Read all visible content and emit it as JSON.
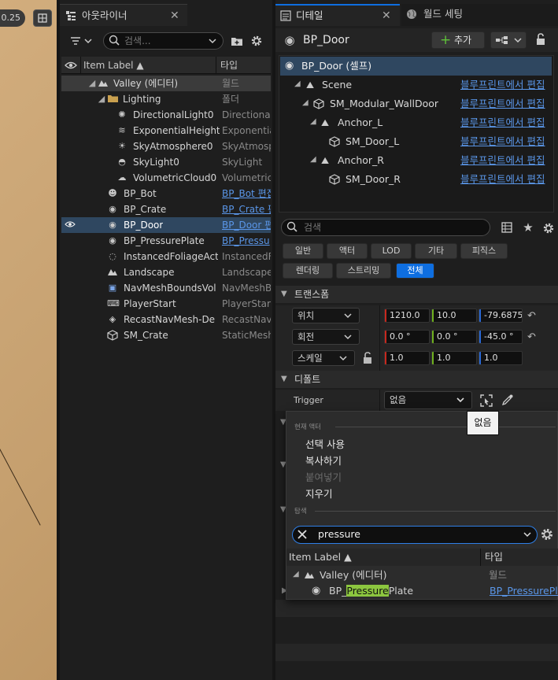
{
  "viewport": {
    "zoom": "0.25"
  },
  "outliner": {
    "tab": "아웃라이너",
    "search_placeholder": "검색...",
    "columns": {
      "label": "Item Label ▲",
      "type": "타입"
    },
    "rows": [
      {
        "label": "Valley (에디터)",
        "type": "월드"
      },
      {
        "label": "Lighting",
        "type": "폴더"
      },
      {
        "label": "DirectionalLight0",
        "type": "Directional"
      },
      {
        "label": "ExponentialHeightF",
        "type": "Exponentia"
      },
      {
        "label": "SkyAtmosphere0",
        "type": "SkyAtmosp"
      },
      {
        "label": "SkyLight0",
        "type": "SkyLight"
      },
      {
        "label": "VolumetricCloud0",
        "type": "Volumetric"
      },
      {
        "label": "BP_Bot",
        "type": "BP_Bot 편집"
      },
      {
        "label": "BP_Crate",
        "type": "BP_Crate 편"
      },
      {
        "label": "BP_Door",
        "type": "BP_Door 편"
      },
      {
        "label": "BP_PressurePlate",
        "type": "BP_Pressu"
      },
      {
        "label": "InstancedFoliageAct",
        "type": "InstancedF"
      },
      {
        "label": "Landscape",
        "type": "Landscape"
      },
      {
        "label": "NavMeshBoundsVol",
        "type": "NavMeshB"
      },
      {
        "label": "PlayerStart",
        "type": "PlayerStart"
      },
      {
        "label": "RecastNavMesh-De",
        "type": "RecastNav"
      },
      {
        "label": "SM_Crate",
        "type": "StaticMesh"
      }
    ]
  },
  "details": {
    "tab": "디테일",
    "world_tab": "월드 세팅",
    "actor_name": "BP_Door",
    "add_label": "추가",
    "components": [
      {
        "name": "BP_Door (셀프)",
        "link": ""
      },
      {
        "name": "Scene",
        "link": "블루프린트에서 편집"
      },
      {
        "name": "SM_Modular_WallDoor",
        "link": "블루프린트에서 편집"
      },
      {
        "name": "Anchor_L",
        "link": "블루프린트에서 편집"
      },
      {
        "name": "SM_Door_L",
        "link": "블루프린트에서 편집"
      },
      {
        "name": "Anchor_R",
        "link": "블루프린트에서 편집"
      },
      {
        "name": "SM_Door_R",
        "link": "블루프린트에서 편집"
      }
    ],
    "search_placeholder": "검색",
    "categories": [
      "일반",
      "액터",
      "LOD",
      "기타",
      "피직스",
      "렌더링",
      "스트리밍",
      "전체"
    ],
    "transform": {
      "title": "트랜스폼",
      "location": {
        "label": "위치",
        "x": "1210.0",
        "y": "10.0",
        "z": "-79.6875"
      },
      "rotation": {
        "label": "회전",
        "x": "0.0 °",
        "y": "0.0 °",
        "z": "-45.0 °"
      },
      "scale": {
        "label": "스케일",
        "x": "1.0",
        "y": "1.0",
        "z": "1.0"
      }
    },
    "default_section": {
      "title": "디폴트",
      "trigger_label": "Trigger",
      "trigger_value": "없음"
    },
    "tooltip": "없음"
  },
  "dropdown_menu": {
    "current_actor_header": "현재 액터",
    "use_selected": "선택 사용",
    "copy": "복사하기",
    "paste": "붙여넣기",
    "clear": "지우기",
    "browse_header": "탐색",
    "search_value": "pressure",
    "columns": {
      "label": "Item Label ▲",
      "type": "타입"
    },
    "tree_world": "Valley (에디터)",
    "tree_world_type": "월드",
    "result": {
      "pre": "BP_",
      "match": "Pressure",
      "post": "Plate",
      "type": "BP_PressurePlate"
    }
  },
  "colors": {
    "accent": "#0e6ee0",
    "selection": "#2f4760",
    "link": "#5a96e8",
    "highlight": "#8cc63f"
  }
}
